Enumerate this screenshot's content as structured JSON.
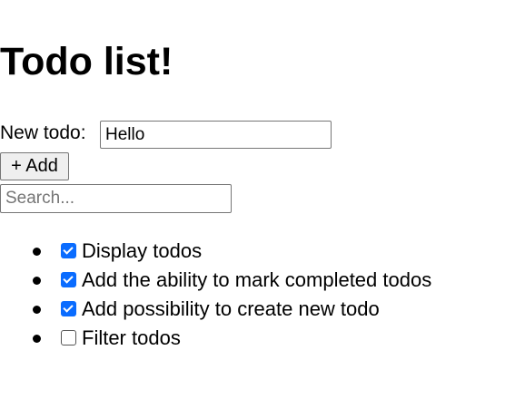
{
  "title": "Todo list!",
  "form": {
    "label": "New todo:",
    "value": "Hello",
    "add_label": "+ Add",
    "search_placeholder": "Search..."
  },
  "todos": [
    {
      "text": "Display todos",
      "done": true
    },
    {
      "text": "Add the ability to mark completed todos",
      "done": true
    },
    {
      "text": "Add possibility to create new todo",
      "done": true
    },
    {
      "text": "Filter todos",
      "done": false
    }
  ]
}
